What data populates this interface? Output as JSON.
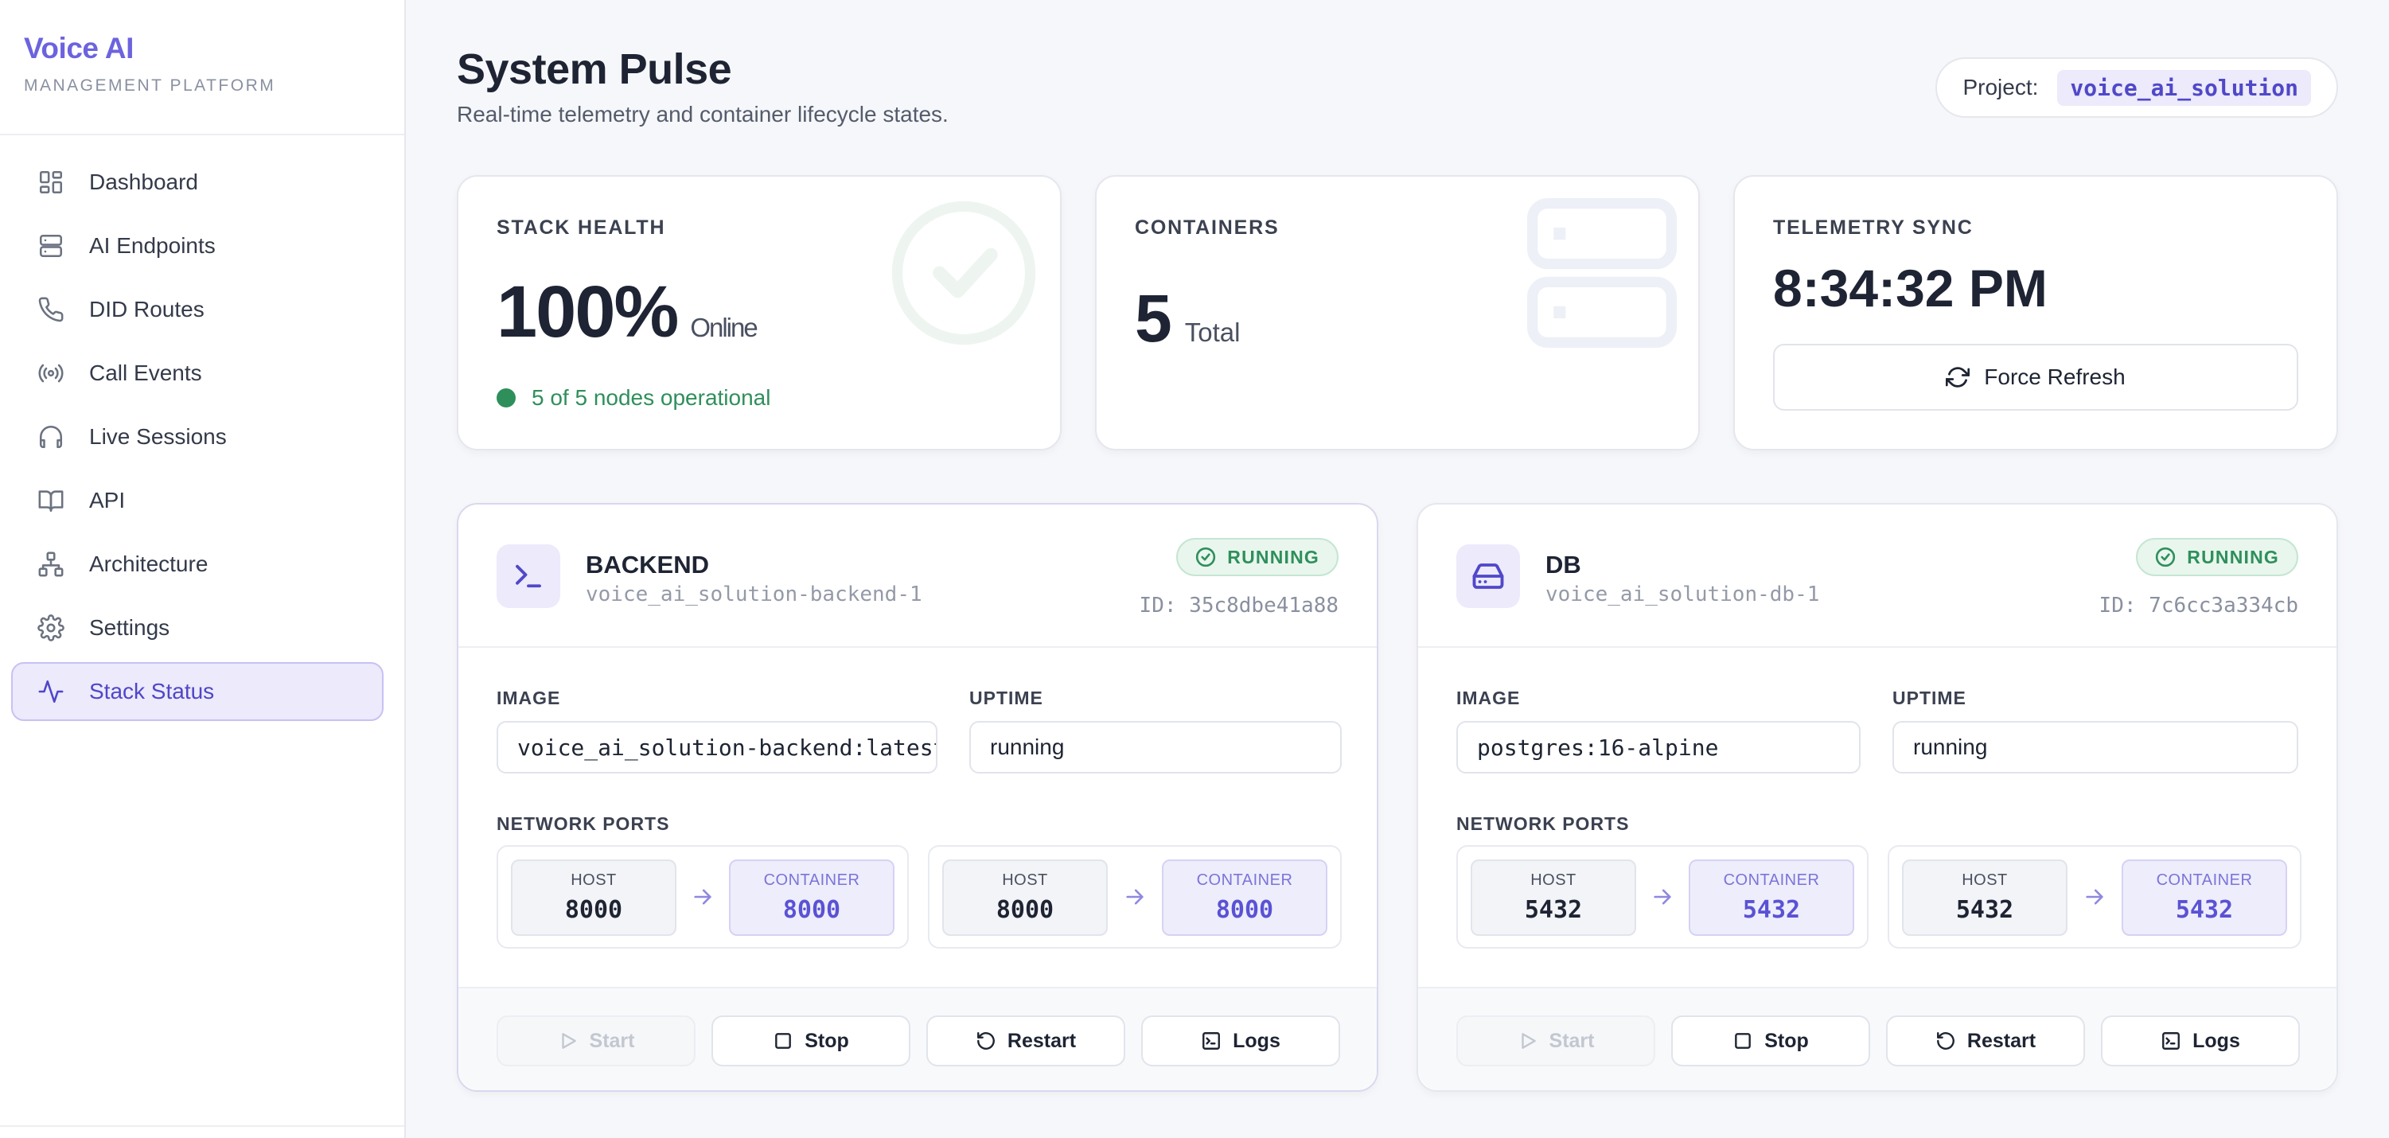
{
  "brand": {
    "title": "Voice AI",
    "subtitle": "MANAGEMENT PLATFORM"
  },
  "sidebar": {
    "items": [
      {
        "label": "Dashboard",
        "icon": "dashboard-icon"
      },
      {
        "label": "AI Endpoints",
        "icon": "server-icon"
      },
      {
        "label": "DID Routes",
        "icon": "phone-icon"
      },
      {
        "label": "Call Events",
        "icon": "broadcast-icon"
      },
      {
        "label": "Live Sessions",
        "icon": "headphones-icon"
      },
      {
        "label": "API",
        "icon": "book-icon"
      },
      {
        "label": "Architecture",
        "icon": "network-icon"
      },
      {
        "label": "Settings",
        "icon": "gear-icon"
      },
      {
        "label": "Stack Status",
        "icon": "activity-icon",
        "active": true
      }
    ]
  },
  "header": {
    "title": "System Pulse",
    "subtitle": "Real-time telemetry and container lifecycle states.",
    "project_label": "Project:",
    "project_value": "voice_ai_solution"
  },
  "stats": {
    "health": {
      "label": "STACK HEALTH",
      "value": "100%",
      "unit": "Online",
      "status": "5 of 5 nodes operational"
    },
    "containers": {
      "label": "CONTAINERS",
      "value": "5",
      "unit": "Total"
    },
    "telemetry": {
      "label": "TELEMETRY SYNC",
      "time": "8:34:32 PM",
      "refresh_label": "Force Refresh"
    }
  },
  "containers": [
    {
      "name": "BACKEND",
      "full_name": "voice_ai_solution-backend-1",
      "status": "RUNNING",
      "id": "ID: 35c8dbe41a88",
      "image_label": "IMAGE",
      "image": "voice_ai_solution-backend:latest",
      "uptime_label": "UPTIME",
      "uptime": "running",
      "ports_label": "NETWORK PORTS",
      "ports": [
        {
          "host_label": "HOST",
          "host": "8000",
          "container_label": "CONTAINER",
          "container": "8000"
        },
        {
          "host_label": "HOST",
          "host": "8000",
          "container_label": "CONTAINER",
          "container": "8000"
        }
      ],
      "actions": {
        "start": "Start",
        "stop": "Stop",
        "restart": "Restart",
        "logs": "Logs"
      }
    },
    {
      "name": "DB",
      "full_name": "voice_ai_solution-db-1",
      "status": "RUNNING",
      "id": "ID: 7c6cc3a334cb",
      "image_label": "IMAGE",
      "image": "postgres:16-alpine",
      "uptime_label": "UPTIME",
      "uptime": "running",
      "ports_label": "NETWORK PORTS",
      "ports": [
        {
          "host_label": "HOST",
          "host": "5432",
          "container_label": "CONTAINER",
          "container": "5432"
        },
        {
          "host_label": "HOST",
          "host": "5432",
          "container_label": "CONTAINER",
          "container": "5432"
        }
      ],
      "actions": {
        "start": "Start",
        "stop": "Stop",
        "restart": "Restart",
        "logs": "Logs"
      }
    }
  ],
  "colors": {
    "accent": "#6c63de",
    "success": "#2f8f5b",
    "background": "#f6f7fa"
  }
}
